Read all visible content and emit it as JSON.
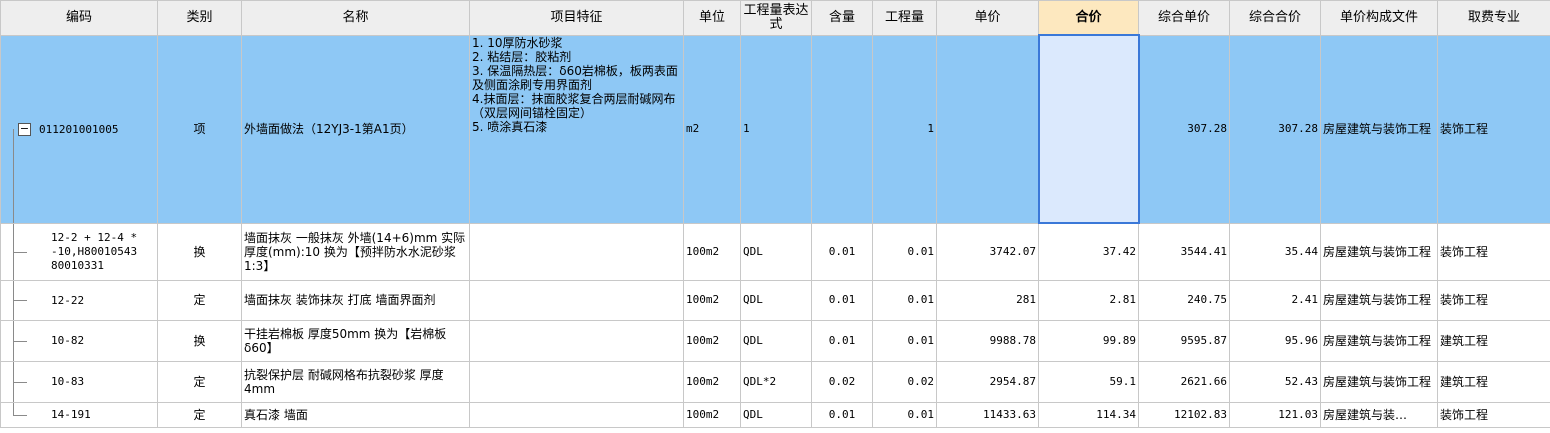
{
  "columns": [
    "编码",
    "类别",
    "名称",
    "项目特征",
    "单位",
    "工程量表达式",
    "含量",
    "工程量",
    "单价",
    "合价",
    "综合单价",
    "综合合价",
    "单价构成文件",
    "取费专业"
  ],
  "active_column": "合价",
  "main_row": {
    "code": "011201001005",
    "category": "项",
    "name": "外墙面做法（12YJ3-1第A1页）",
    "feature": "1. 10厚防水砂浆\n2. 粘结层：胶粘剂\n3. 保温隔热层：δ60岩棉板，板两表面及侧面涂刷专用界面剂\n4.抹面层：抹面胶浆复合两层耐碱网布（双层网间锚栓固定）\n5. 喷涂真石漆",
    "unit": "m2",
    "expression": "1",
    "content": "",
    "quantity": "1",
    "price": "",
    "total": "",
    "comp_price": "307.28",
    "comp_total": "307.28",
    "file": "房屋建筑与装饰工程",
    "specialty": "装饰工程"
  },
  "rows": [
    {
      "code": "12-2 + 12-4 * -10,H80010543 80010331",
      "category": "换",
      "name": "墙面抹灰 一般抹灰 外墙(14+6)mm 实际厚度(mm):10 换为【预拌防水水泥砂浆 1:3】",
      "unit": "100m2",
      "expression": "QDL",
      "content": "0.01",
      "quantity": "0.01",
      "price": "3742.07",
      "total": "37.42",
      "comp_price": "3544.41",
      "comp_total": "35.44",
      "file": "房屋建筑与装饰工程",
      "specialty": "装饰工程"
    },
    {
      "code": "12-22",
      "category": "定",
      "name": "墙面抹灰 装饰抹灰 打底 墙面界面剂",
      "unit": "100m2",
      "expression": "QDL",
      "content": "0.01",
      "quantity": "0.01",
      "price": "281",
      "total": "2.81",
      "comp_price": "240.75",
      "comp_total": "2.41",
      "file": "房屋建筑与装饰工程",
      "specialty": "装饰工程"
    },
    {
      "code": "10-82",
      "category": "换",
      "name": "干挂岩棉板 厚度50mm 换为【岩棉板δ60】",
      "unit": "100m2",
      "expression": "QDL",
      "content": "0.01",
      "quantity": "0.01",
      "price": "9988.78",
      "total": "99.89",
      "comp_price": "9595.87",
      "comp_total": "95.96",
      "file": "房屋建筑与装饰工程",
      "specialty": "建筑工程"
    },
    {
      "code": "10-83",
      "category": "定",
      "name": "抗裂保护层 耐碱网格布抗裂砂浆 厚度4mm",
      "unit": "100m2",
      "expression": "QDL*2",
      "content": "0.02",
      "quantity": "0.02",
      "price": "2954.87",
      "total": "59.1",
      "comp_price": "2621.66",
      "comp_total": "52.43",
      "file": "房屋建筑与装饰工程",
      "specialty": "建筑工程"
    },
    {
      "code": "14-191",
      "category": "定",
      "name": "真石漆 墙面",
      "unit": "100m2",
      "expression": "QDL",
      "content": "0.01",
      "quantity": "0.01",
      "price": "11433.63",
      "total": "114.34",
      "comp_price": "12102.83",
      "comp_total": "121.03",
      "file": "房屋建筑与装…",
      "specialty": "装饰工程"
    }
  ],
  "icons": {
    "collapse": "minus-box-icon"
  },
  "colors": {
    "selected_row": "#8ec8f5",
    "selected_cell": "#dbe9fd",
    "active_header": "#fde8bf"
  }
}
